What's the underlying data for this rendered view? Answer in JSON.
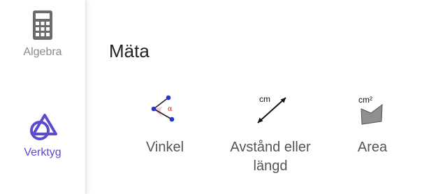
{
  "sidebar": {
    "items": [
      {
        "label": "Algebra",
        "icon": "calculator-icon",
        "active": false
      },
      {
        "label": "Verktyg",
        "icon": "tools-icon",
        "active": true
      }
    ],
    "active_color": "#5b4cce",
    "inactive_color": "#8a8a8a"
  },
  "main": {
    "section_title": "Mäta",
    "tools": [
      {
        "label": "Vinkel",
        "icon": "angle-icon",
        "icon_text": "α"
      },
      {
        "label": "Avstånd eller längd",
        "icon": "distance-icon",
        "icon_text": "cm"
      },
      {
        "label": "Area",
        "icon": "area-icon",
        "icon_text": "cm²"
      }
    ]
  }
}
